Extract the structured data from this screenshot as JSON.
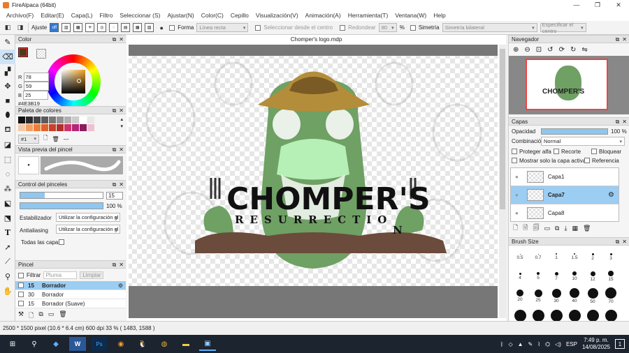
{
  "window": {
    "title": "FireAlpaca (64bit)"
  },
  "menu": [
    "Archivo(F)",
    "Editar(E)",
    "Capa(L)",
    "Filtro",
    "Seleccionar (S)",
    "Ajustar(N)",
    "Color(C)",
    "Cepillo",
    "Visualización(V)",
    "Animación(A)",
    "Herramienta(T)",
    "Ventana(W)",
    "Help"
  ],
  "toolbar": {
    "snap_label": "Ajuste",
    "snap_off": "off",
    "forma_label": "Forma",
    "forma_value": "Línea recta",
    "select_center_label": "Seleccionar desde el centro",
    "round_label": "Redondear",
    "round_value": "80",
    "round_unit": "%",
    "symmetry_label": "Simetría",
    "symmetry_value": "Simetría bilateral",
    "center_button": "Especificar el centro"
  },
  "color_panel": {
    "title": "Color",
    "r": "78",
    "g": "59",
    "b": "25",
    "hex": "#4E3B19",
    "fg_color": "#4e3b19"
  },
  "palette_panel": {
    "title": "Paleta de colores",
    "selector": "#1",
    "dashes": "---",
    "swatches": [
      "#111111",
      "#2b2b2b",
      "#444444",
      "#5c5c5c",
      "#777777",
      "#939393",
      "#b0b0b0",
      "#cccccc",
      "#ffffff",
      "#e8e8e8",
      "#f5c9a8",
      "#f2a06a",
      "#ee7f3a",
      "#e0622a",
      "#c84028",
      "#b12f2c",
      "#cc3366",
      "#b8237a",
      "#8d1c5e",
      "#f0c0d0"
    ]
  },
  "brush_preview": {
    "title": "Vista previa del pincel",
    "size": "15"
  },
  "brush_control": {
    "title": "Control del pinceles",
    "size_value": "15",
    "opacity_value": "100 %",
    "opacity_level": 1.0,
    "stabilizer_label": "Estabilizador",
    "stabilizer_value": "Utilizar la configuración gl",
    "antialias_label": "Antialiasing",
    "antialias_value": "Utilizar la configuración gl",
    "all_layers_label": "Todas las capas"
  },
  "brush_list": {
    "title": "Pincel",
    "filter_label": "Filtrar",
    "filter_placeholder": "Pluma",
    "clear_button": "Limpiar",
    "items": [
      {
        "size": "15",
        "name": "Borrador",
        "selected": true
      },
      {
        "size": "30",
        "name": "Borrador",
        "selected": false
      },
      {
        "size": "15",
        "name": "Borrador (Suave)",
        "selected": false
      }
    ]
  },
  "canvas": {
    "title": "Chomper's logo.mdp",
    "logo_text": "CHOMPER'S",
    "logo_sub": "RESURRECTIO",
    "logo_n": "N"
  },
  "navigator": {
    "title": "Navegador",
    "thumb_text": "CHOMPER'S"
  },
  "layers_panel": {
    "title": "Capas",
    "opacity_label": "Opacidad",
    "opacity_value": "100 %",
    "opacity_level": 1.0,
    "blend_label": "Combinación",
    "blend_value": "Normal",
    "protect_alpha": "Proteger alfa",
    "clipping": "Recorte",
    "lock": "Bloquear",
    "show_active": "Mostrar solo la capa activa",
    "reference": "Referencia",
    "layers": [
      {
        "name": "Capa1",
        "selected": false
      },
      {
        "name": "Capa7",
        "selected": true
      },
      {
        "name": "Capa8",
        "selected": false
      }
    ]
  },
  "brush_size": {
    "title": "Brush Size",
    "rows": [
      [
        "0.5",
        "0.7",
        "1",
        "1.5",
        "2",
        "3"
      ],
      [
        "4",
        "5",
        "7",
        "10",
        "12",
        "15"
      ],
      [
        "20",
        "25",
        "30",
        "40",
        "50",
        "70"
      ],
      [
        "",
        "",
        "",
        "",
        "",
        ""
      ]
    ]
  },
  "status": {
    "text": "2500 * 1500 pixel  (10.6 * 6.4 cm)  600 dpi  33 %  ( 1483, 1588 )"
  },
  "taskbar": {
    "lang": "ESP",
    "time": "7:49 p. m.",
    "date": "14/08/2025",
    "notif_count": "1"
  }
}
